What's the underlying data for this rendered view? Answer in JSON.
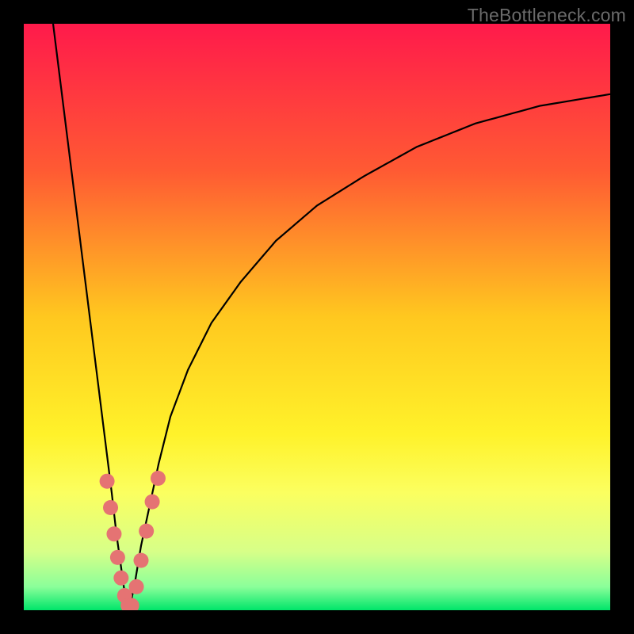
{
  "watermark": "TheBottleneck.com",
  "chart_data": {
    "type": "line",
    "title": "",
    "xlabel": "",
    "ylabel": "",
    "xlim": [
      0,
      100
    ],
    "ylim": [
      0,
      100
    ],
    "grid": false,
    "legend": false,
    "background_gradient": {
      "stops": [
        {
          "offset": 0.0,
          "color": "#ff1a4b"
        },
        {
          "offset": 0.25,
          "color": "#ff5a33"
        },
        {
          "offset": 0.5,
          "color": "#ffc81f"
        },
        {
          "offset": 0.7,
          "color": "#fff22a"
        },
        {
          "offset": 0.8,
          "color": "#fbff60"
        },
        {
          "offset": 0.9,
          "color": "#d7ff88"
        },
        {
          "offset": 0.96,
          "color": "#8bff9a"
        },
        {
          "offset": 1.0,
          "color": "#00e56a"
        }
      ]
    },
    "series": [
      {
        "name": "curve-left",
        "x": [
          5.0,
          6.0,
          7.0,
          8.0,
          9.0,
          10.0,
          11.0,
          12.0,
          13.0,
          14.0,
          15.0,
          15.8,
          16.5,
          17.2,
          18.0
        ],
        "y": [
          100,
          92,
          84,
          76,
          68,
          60,
          52,
          44,
          36,
          28,
          20,
          13,
          8,
          3,
          0
        ]
      },
      {
        "name": "curve-right",
        "x": [
          18.0,
          19.0,
          20.0,
          21.5,
          23.0,
          25.0,
          28.0,
          32.0,
          37.0,
          43.0,
          50.0,
          58.0,
          67.0,
          77.0,
          88.0,
          100.0
        ],
        "y": [
          0,
          5,
          11,
          18,
          25,
          33,
          41,
          49,
          56,
          63,
          69,
          74,
          79,
          83,
          86,
          88
        ]
      }
    ],
    "marker_clusters": [
      {
        "name": "cluster-left",
        "points": [
          {
            "x": 14.2,
            "y": 22.0
          },
          {
            "x": 14.8,
            "y": 17.5
          },
          {
            "x": 15.4,
            "y": 13.0
          },
          {
            "x": 16.0,
            "y": 9.0
          },
          {
            "x": 16.6,
            "y": 5.5
          },
          {
            "x": 17.2,
            "y": 2.5
          },
          {
            "x": 17.8,
            "y": 0.8
          }
        ]
      },
      {
        "name": "cluster-right",
        "points": [
          {
            "x": 18.4,
            "y": 0.8
          },
          {
            "x": 19.2,
            "y": 4.0
          },
          {
            "x": 20.0,
            "y": 8.5
          },
          {
            "x": 20.9,
            "y": 13.5
          },
          {
            "x": 21.9,
            "y": 18.5
          },
          {
            "x": 22.9,
            "y": 22.5
          }
        ]
      }
    ],
    "marker_color": "#e57373",
    "curve_color": "#000000"
  }
}
